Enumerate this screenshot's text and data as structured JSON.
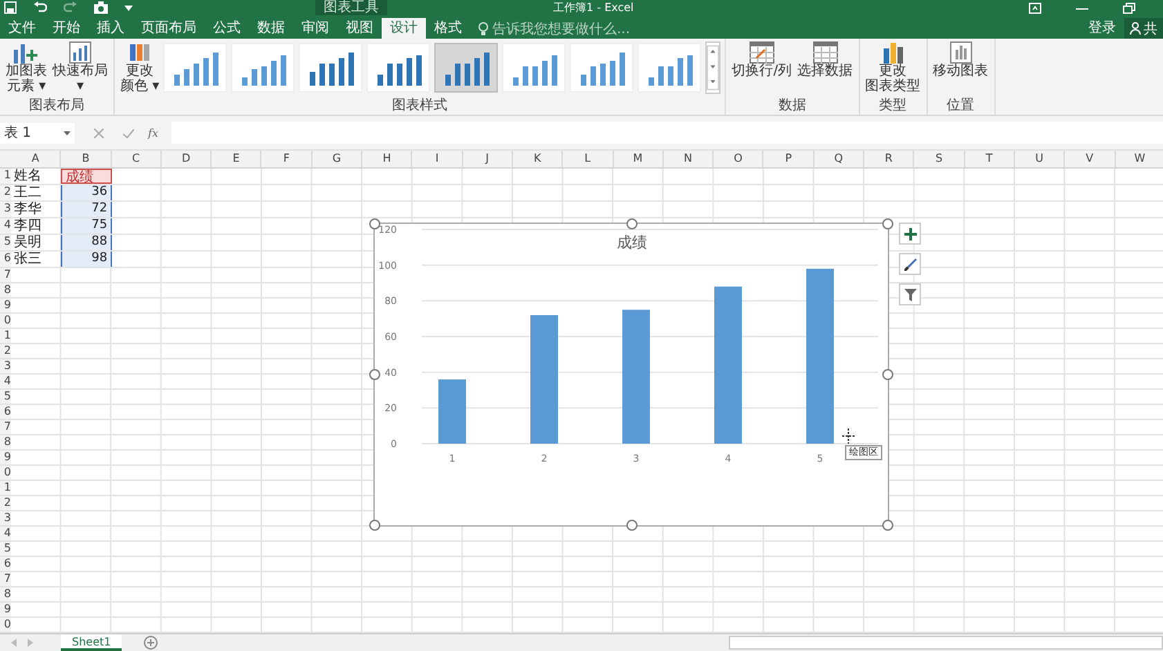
{
  "window": {
    "title": "工作簿1 - Excel",
    "context_tab": "图表工具"
  },
  "account": {
    "sign_in": "登录",
    "share": "共"
  },
  "menu_tabs": [
    {
      "label": "文件",
      "selected": false
    },
    {
      "label": "开始",
      "selected": false
    },
    {
      "label": "插入",
      "selected": false
    },
    {
      "label": "页面布局",
      "selected": false
    },
    {
      "label": "公式",
      "selected": false
    },
    {
      "label": "数据",
      "selected": false
    },
    {
      "label": "审阅",
      "selected": false
    },
    {
      "label": "视图",
      "selected": false
    },
    {
      "label": "设计",
      "selected": true
    },
    {
      "label": "格式",
      "selected": false
    }
  ],
  "tell_me": {
    "placeholder": "告诉我您想要做什么..."
  },
  "ribbon": {
    "layout_group": {
      "label": "图表布局",
      "add_element": [
        "加图表",
        "元素 ▾"
      ],
      "quick_layout": [
        "快速布局",
        "▾"
      ]
    },
    "color_button": [
      "更改",
      "颜色 ▾"
    ],
    "styles_group": {
      "label": "图表样式",
      "styles": [
        {
          "selected": false
        },
        {
          "selected": false
        },
        {
          "selected": false
        },
        {
          "selected": false
        },
        {
          "selected": true
        },
        {
          "selected": false
        },
        {
          "selected": false
        },
        {
          "selected": false
        }
      ]
    },
    "data_group": {
      "label": "数据",
      "buttons": [
        "切换行/列",
        "选择数据"
      ]
    },
    "type_group": {
      "label": "类型",
      "button": [
        "更改",
        "图表类型"
      ]
    },
    "location_group": {
      "label": "位置",
      "button": "移动图表"
    }
  },
  "formula_bar": {
    "name_box": "表 1",
    "fx": "fx"
  },
  "columns": [
    "A",
    "B",
    "C",
    "D",
    "E",
    "F",
    "G",
    "H",
    "I",
    "J",
    "K",
    "L",
    "M",
    "N",
    "O",
    "P",
    "Q",
    "R",
    "S",
    "T",
    "U",
    "V",
    "W"
  ],
  "row_numbers": [
    "1",
    "2",
    "3",
    "4",
    "5",
    "6",
    "7",
    "8",
    "9",
    "0",
    "1",
    "2",
    "3",
    "4",
    "5",
    "6",
    "7",
    "8",
    "9",
    "0",
    "1",
    "2",
    "3",
    "4",
    "5",
    "6",
    "7",
    "8",
    "9",
    "0"
  ],
  "cells": [
    [
      "姓名",
      "成绩"
    ],
    [
      "王二",
      "36"
    ],
    [
      "李华",
      "72"
    ],
    [
      "李四",
      "75"
    ],
    [
      "吴明",
      "88"
    ],
    [
      "张三",
      "98"
    ]
  ],
  "chart": {
    "chart_data": {
      "type": "bar",
      "title": "成绩",
      "categories": [
        "1",
        "2",
        "3",
        "4",
        "5"
      ],
      "series": [
        {
          "color": "#5b9bd5",
          "values": [
            36,
            72,
            75,
            88,
            98
          ]
        }
      ],
      "grid": true,
      "ylim": [
        0,
        120
      ],
      "yticks": [
        0,
        20,
        40,
        60,
        80,
        100,
        120
      ]
    },
    "tooltip": "绘图区"
  },
  "sheet_tabs": [
    {
      "label": "Sheet1",
      "selected": true
    }
  ]
}
